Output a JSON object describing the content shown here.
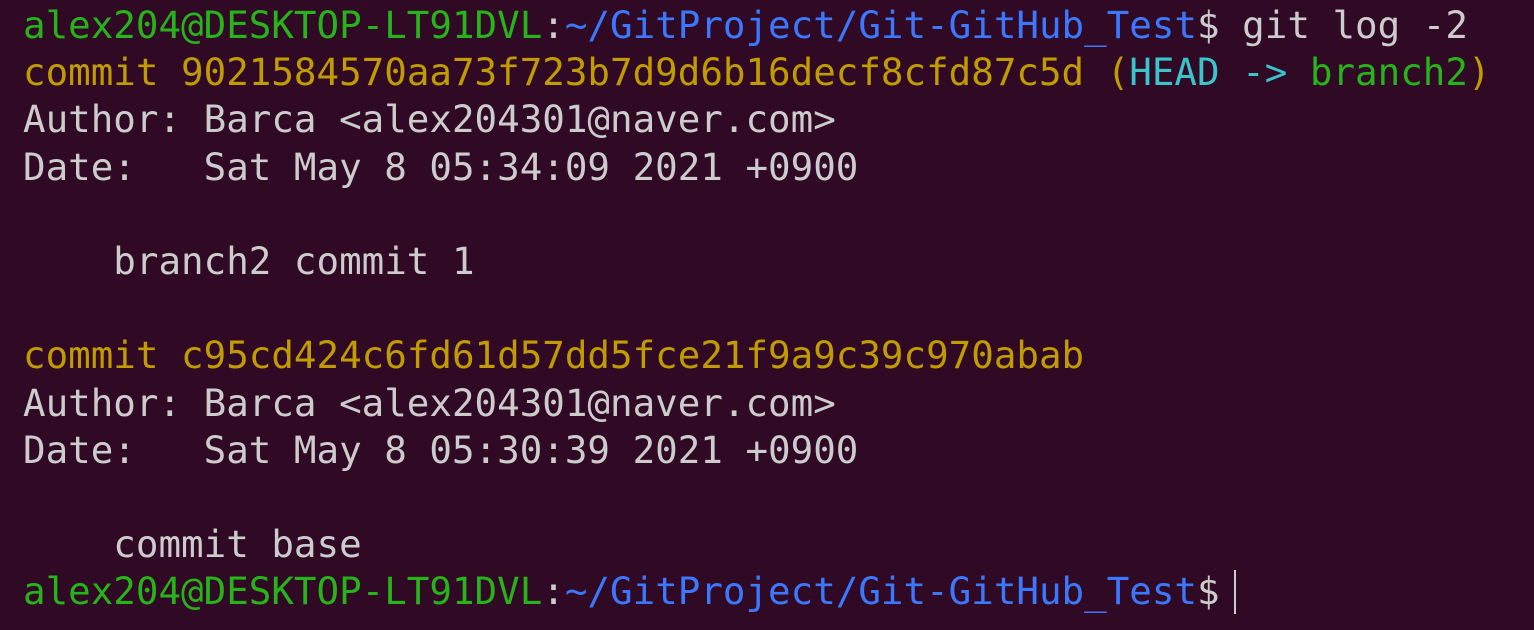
{
  "prompt": {
    "user_host": "alex204@DESKTOP-LT91DVL",
    "separator": ":",
    "path": "~/GitProject/Git-GitHub_Test",
    "symbol": "$"
  },
  "command": " git log -2",
  "commits": [
    {
      "keyword": "commit ",
      "hash": "9021584570aa73f723b7d9d6b16decf8cfd87c5d",
      "ref_open": " (",
      "ref_head": "HEAD",
      "ref_arrow": " -> ",
      "ref_branch": "branch2",
      "ref_close": ")",
      "author_line": "Author: Barca <alex204301@naver.com>",
      "date_line": "Date:   Sat May 8 05:34:09 2021 +0900",
      "message": "    branch2 commit 1"
    },
    {
      "keyword": "commit ",
      "hash": "c95cd424c6fd61d57dd5fce21f9a9c39c970abab",
      "author_line": "Author: Barca <alex204301@naver.com>",
      "date_line": "Date:   Sat May 8 05:30:39 2021 +0900",
      "message": "    commit base"
    }
  ],
  "colors": {
    "background": "#300a24",
    "user_host": "#26b41a",
    "path": "#3b78ff",
    "text": "#cccccc",
    "commit_hash": "#c19c00",
    "head": "#3ac4cc",
    "branch": "#26b41a"
  }
}
